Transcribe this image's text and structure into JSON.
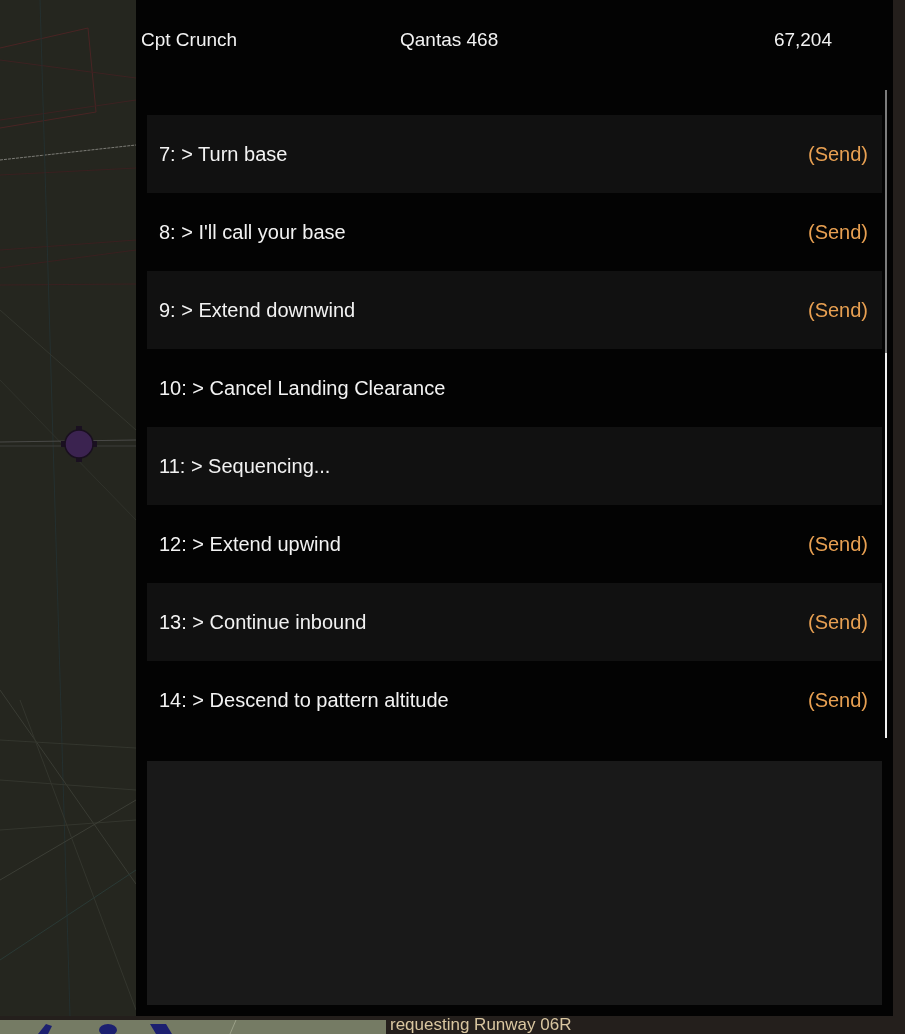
{
  "header": {
    "pilot": "Cpt Crunch",
    "flight": "Qantas 468",
    "score": "67,204"
  },
  "commands": [
    {
      "label": "7: > Turn base",
      "action": "(Send)"
    },
    {
      "label": "8: > I'll call your base",
      "action": "(Send)"
    },
    {
      "label": "9: > Extend downwind",
      "action": "(Send)"
    },
    {
      "label": "10: > Cancel Landing Clearance"
    },
    {
      "label": "11: > Sequencing..."
    },
    {
      "label": "12: > Extend upwind",
      "action": "(Send)"
    },
    {
      "label": "13: > Continue inbound",
      "action": "(Send)"
    },
    {
      "label": "14: > Descend to pattern altitude",
      "action": "(Send)"
    }
  ],
  "scene": {
    "caption": "requesting Runway 06R"
  }
}
